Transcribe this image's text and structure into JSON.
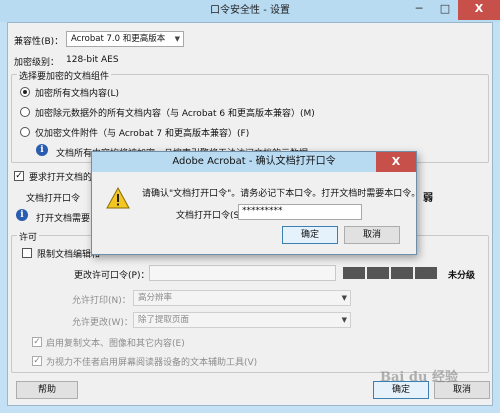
{
  "window": {
    "title": "口令安全性 - 设置",
    "minimize": "─",
    "maximize": "□",
    "close": "X"
  },
  "compat": {
    "label": "兼容性(B)：",
    "value": "Acrobat 7.0 和更高版本"
  },
  "encryption": {
    "label": "加密级别：",
    "value": "128-bit AES"
  },
  "components": {
    "title": "选择要加密的文档组件",
    "options": [
      {
        "label": "加密所有文档内容(L)",
        "checked": true
      },
      {
        "label": "加密除元数据外的所有文档内容（与 Acrobat 6 和更高版本兼容）(M)",
        "checked": false
      },
      {
        "label": "仅加密文件附件（与 Acrobat 7 和更高版本兼容）(F)",
        "checked": false
      }
    ],
    "info": "文档所有内容均将被加密，且搜索引擎将无法访问文档的元数据。"
  },
  "open_password": {
    "require_label": "要求打开文档的口令",
    "field_label": "文档打开口令",
    "info": "打开文档需要",
    "strength": "弱"
  },
  "permissions": {
    "title": "许可",
    "restrict_label": "限制文档编辑和",
    "change_password_label": "更改许可口令(P)：",
    "strength": "未分级",
    "printing_label": "允许打印(N)：",
    "printing_value": "高分辨率",
    "changes_label": "允许更改(W)：",
    "changes_value": "除了提取页面",
    "copy_label": "启用复制文本、图像和其它内容(E)",
    "accessibility_label": "为视力不佳者启用屏幕阅读器设备的文本辅助工具(V)"
  },
  "footer": {
    "help": "帮助",
    "ok": "确定",
    "cancel": "取消"
  },
  "modal": {
    "title": "Adobe Acrobat - 确认文档打开口令",
    "close": "X",
    "message": "请确认\"文档打开口令\"。请务必记下本口令。打开文档时需要本口令。",
    "field_label": "文档打开口令(S)：",
    "field_value": "*********",
    "ok": "确定",
    "cancel": "取消"
  },
  "colors": {
    "titlebar": "#b8dbf2",
    "close": "#c7504b",
    "client": "#f0f0f0"
  },
  "watermark": "Bai du 经验"
}
